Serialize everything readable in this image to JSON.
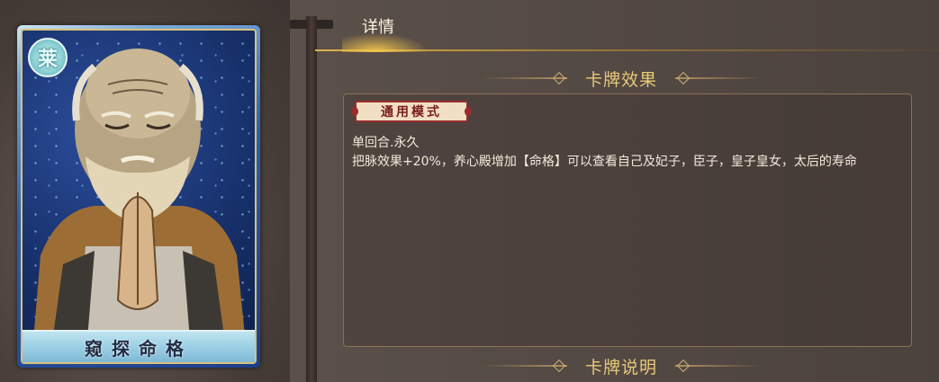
{
  "card": {
    "badge": "莱",
    "name": "窥探命格"
  },
  "tabs": {
    "detail_label": "详情"
  },
  "sections": {
    "card_effect_title": "卡牌效果",
    "card_description_title": "卡牌说明"
  },
  "effect": {
    "mode_tag": "通用模式",
    "line1": "单回合.永久",
    "line2": "把脉效果+20%，养心殿增加【命格】可以查看自己及妃子，臣子，皇子皇女，太后的寿命"
  },
  "colors": {
    "accent_gold": "#e7c979",
    "card_blue": "#2f5fae",
    "tag_red": "#9b2c2c"
  }
}
